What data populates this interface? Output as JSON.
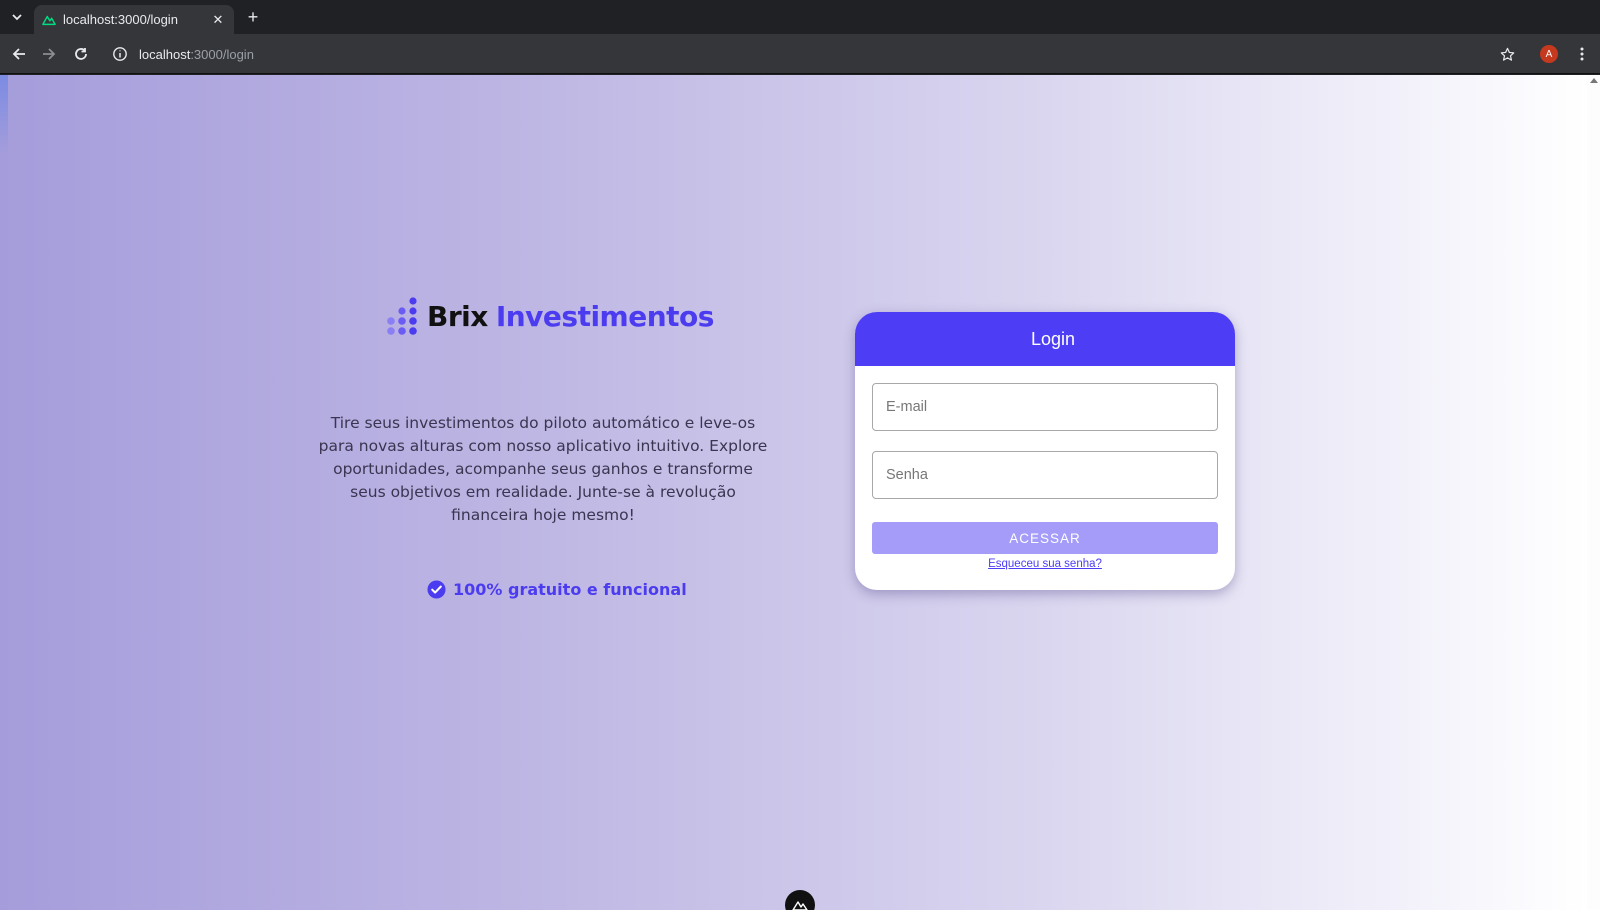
{
  "browser": {
    "tab_title": "localhost:3000/login",
    "url_host": "localhost",
    "url_path": ":3000/login",
    "profile_initial": "A"
  },
  "hero": {
    "brand_name": "Brix",
    "brand_accent": "Investimentos",
    "description": "Tire seus investimentos do piloto automático e leve-os para novas alturas com nosso aplicativo intuitivo. Explore oportunidades, acompanhe seus ganhos e transforme seus objetivos em realidade. Junte-se à revolução financeira hoje mesmo!",
    "badge": "100% gratuito e funcional"
  },
  "login": {
    "title": "Login",
    "email_placeholder": "E-mail",
    "password_placeholder": "Senha",
    "submit_label": "ACESSAR",
    "forgot_label": "Esqueceu sua senha?"
  },
  "colors": {
    "accent": "#4d3ef6",
    "button_disabled": "#a49cf8"
  },
  "icons": [
    "tab-list-icon",
    "nuxt-favicon-icon",
    "close-icon",
    "plus-icon",
    "back-arrow-icon",
    "forward-arrow-icon",
    "reload-icon",
    "info-icon",
    "star-icon",
    "kebab-menu-icon",
    "brand-dots-logo-icon",
    "check-circle-icon",
    "nuxt-devtools-icon"
  ]
}
